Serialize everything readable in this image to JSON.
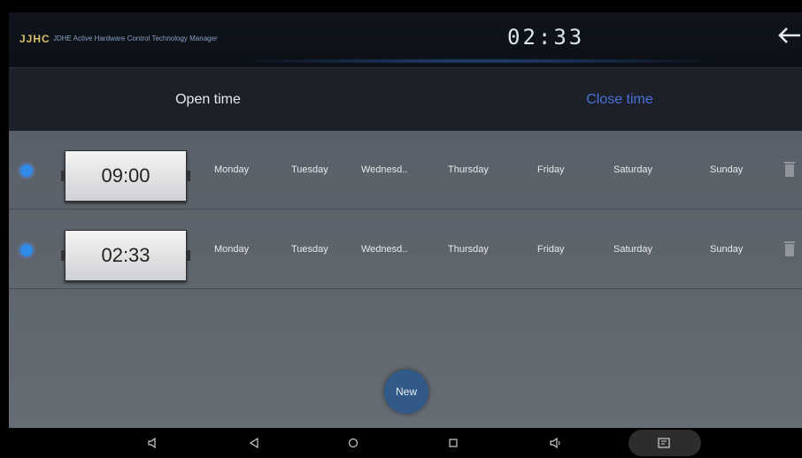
{
  "header": {
    "logo": "JJHC",
    "app_title": "JDHE Active Hardware Control Technology Manager",
    "clock": "02:33"
  },
  "tabs": [
    {
      "label": "Open time",
      "active": false
    },
    {
      "label": "Close time",
      "active": true
    }
  ],
  "schedules": [
    {
      "time": "09:00",
      "enabled": true,
      "days": [
        "Monday",
        "Tuesday",
        "Wednesd..",
        "Thursday",
        "Friday",
        "Saturday",
        "Sunday"
      ]
    },
    {
      "time": "02:33",
      "enabled": true,
      "days": [
        "Monday",
        "Tuesday",
        "Wednesd..",
        "Thursday",
        "Friday",
        "Saturday",
        "Sunday"
      ]
    }
  ],
  "new_button": "New",
  "colors": {
    "accent": "#4a6fd8",
    "radio": "#2f8ae8",
    "new_button": "#315a88"
  },
  "navbar": {
    "icons": [
      "volume-down-icon",
      "back-triangle-icon",
      "home-circle-icon",
      "recents-square-icon",
      "volume-up-icon",
      "screenshot-icon"
    ]
  }
}
